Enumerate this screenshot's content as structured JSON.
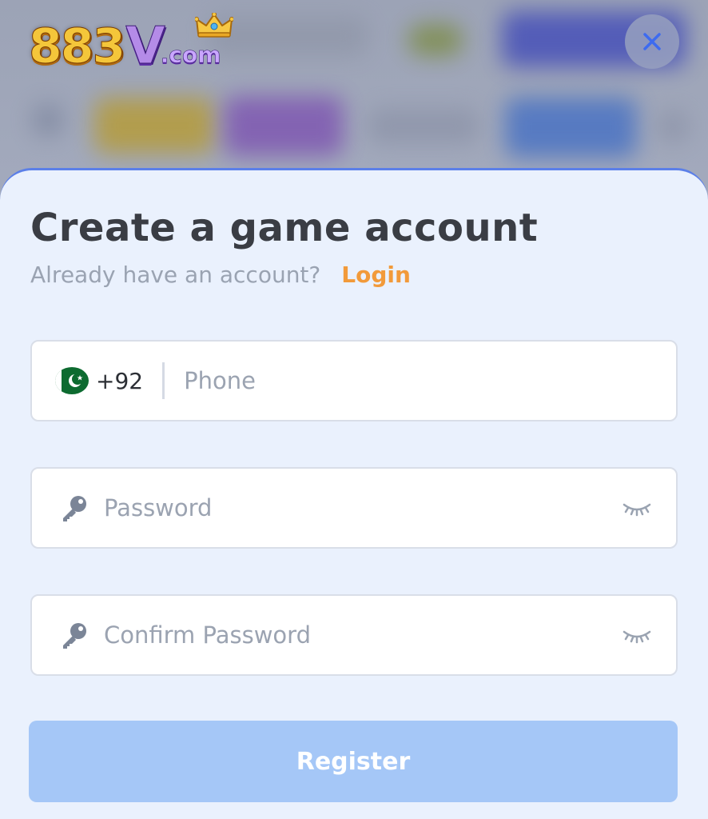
{
  "logo": {
    "number": "883",
    "letter": "V",
    "suffix": ".com"
  },
  "header": {
    "close_icon": "close-icon"
  },
  "form": {
    "title": "Create a game account",
    "subtitle": "Already have an account?",
    "login_label": "Login",
    "phone": {
      "country_code": "+92",
      "placeholder": "Phone",
      "flag": "pakistan-flag-icon"
    },
    "password": {
      "placeholder": "Password",
      "icon": "key-icon",
      "toggle_icon": "eye-closed-icon"
    },
    "confirm_password": {
      "placeholder": "Confirm Password",
      "icon": "key-icon",
      "toggle_icon": "eye-closed-icon"
    },
    "register_label": "Register"
  },
  "colors": {
    "accent": "#f29a3a",
    "sheet_bg": "#eaf1fd",
    "sheet_border": "#5b7fe8",
    "register_bg": "#a5c7f7",
    "title": "#3a3d44",
    "muted": "#9aa3b2"
  }
}
